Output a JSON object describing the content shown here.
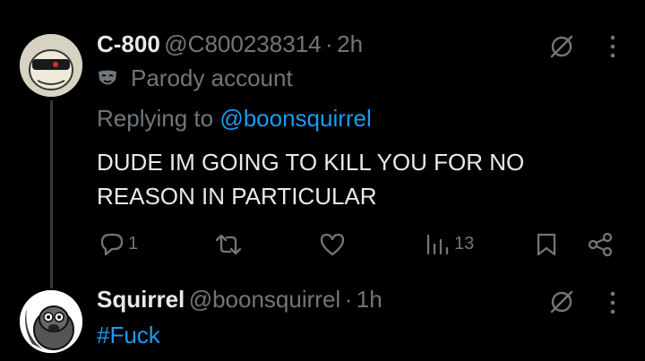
{
  "tweet": {
    "display_name": "C-800",
    "handle": "@C800238314",
    "separator": "·",
    "time": "2h",
    "badge_label": "Parody account",
    "replying_prefix": "Replying to",
    "replying_to": "@boonsquirrel",
    "text_line1": "DUDE IM GOING TO KILL YOU FOR NO",
    "text_line2": "REASON IN PARTICULAR",
    "reply_count": "1",
    "view_count": "13"
  },
  "reply": {
    "display_name": "Squirrel",
    "handle": "@boonsquirrel",
    "separator": "·",
    "time": "1h",
    "text": "#Fuck"
  },
  "colors": {
    "background": "#000000",
    "text_primary": "#e7e9ea",
    "text_secondary": "#71767b",
    "link": "#1d9bf0"
  },
  "icons": [
    "grok-icon",
    "more-icon",
    "parody-mask-icon",
    "reply-icon",
    "retweet-icon",
    "like-icon",
    "views-icon",
    "bookmark-icon",
    "share-icon"
  ]
}
